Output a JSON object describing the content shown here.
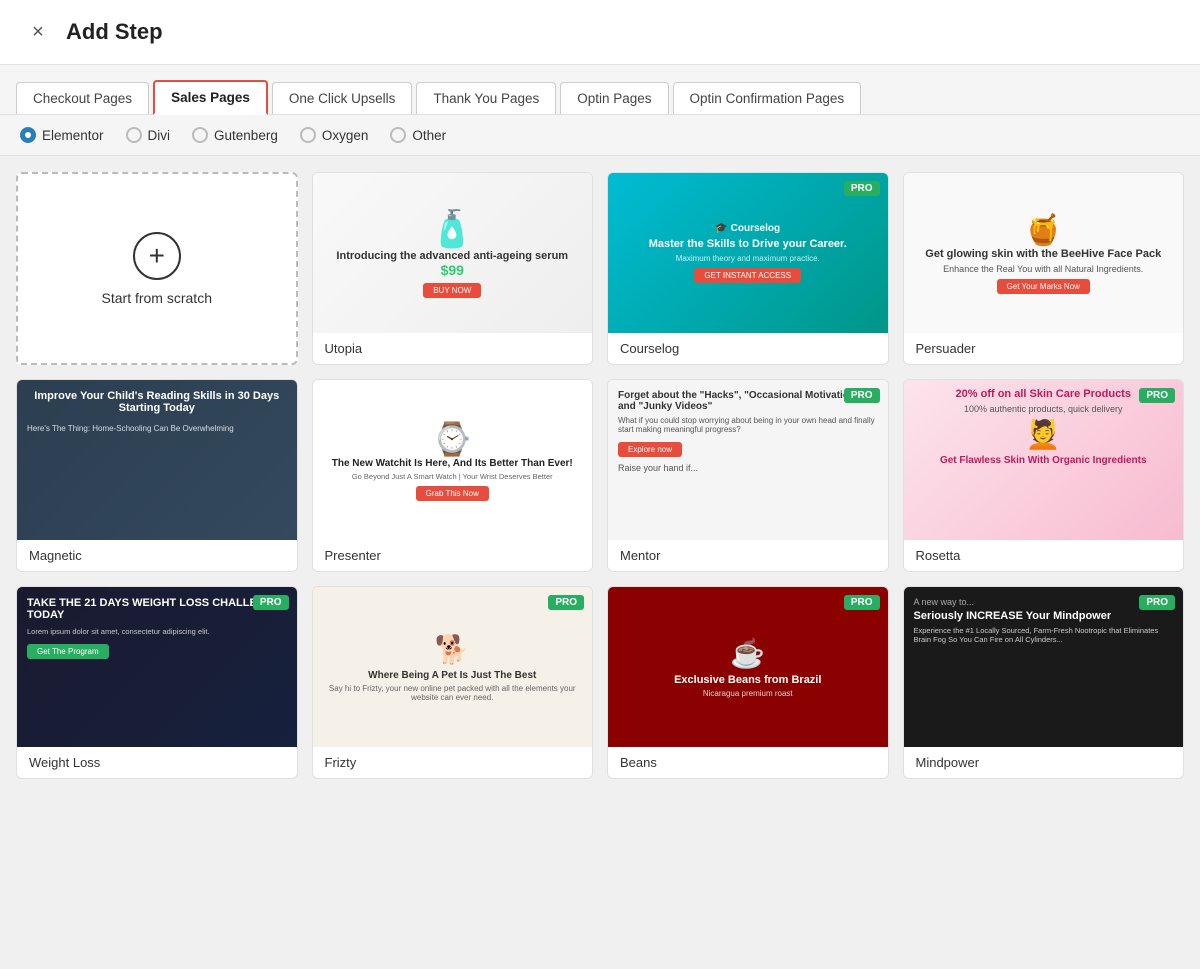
{
  "header": {
    "title": "Add Step",
    "close_label": "×"
  },
  "tabs": [
    {
      "id": "checkout",
      "label": "Checkout Pages",
      "active": false
    },
    {
      "id": "sales",
      "label": "Sales Pages",
      "active": true
    },
    {
      "id": "one-click",
      "label": "One Click Upsells",
      "active": false
    },
    {
      "id": "thankyou",
      "label": "Thank You Pages",
      "active": false
    },
    {
      "id": "optin",
      "label": "Optin Pages",
      "active": false
    },
    {
      "id": "optin-confirm",
      "label": "Optin Confirmation Pages",
      "active": false
    }
  ],
  "builders": [
    {
      "id": "elementor",
      "label": "Elementor",
      "selected": true
    },
    {
      "id": "divi",
      "label": "Divi",
      "selected": false
    },
    {
      "id": "gutenberg",
      "label": "Gutenberg",
      "selected": false
    },
    {
      "id": "oxygen",
      "label": "Oxygen",
      "selected": false
    },
    {
      "id": "other",
      "label": "Other",
      "selected": false
    }
  ],
  "scratch": {
    "label": "Start from scratch"
  },
  "templates": [
    {
      "id": "utopia",
      "name": "Utopia",
      "pro": false,
      "thumb_type": "utopia",
      "description": "Introducing the advanced anti-ageing serum"
    },
    {
      "id": "courselog",
      "name": "Courselog",
      "pro": true,
      "thumb_type": "courselog",
      "description": "Master the Skills to Drive your Career."
    },
    {
      "id": "persuader",
      "name": "Persuader",
      "pro": false,
      "thumb_type": "persuader",
      "description": "Get glowing skin with the BeeHive Face Pack"
    },
    {
      "id": "magnetic",
      "name": "Magnetic",
      "pro": false,
      "thumb_type": "magnetic",
      "description": "Improve Your Child's Reading Skills in 30 Days Starting Today"
    },
    {
      "id": "presenter",
      "name": "Presenter",
      "pro": false,
      "thumb_type": "presenter",
      "description": "Go Beyond Just A Smart Watch | Your Wrist Deserves Better"
    },
    {
      "id": "mentor",
      "name": "Mentor",
      "pro": true,
      "thumb_type": "mentor",
      "description": "Raise your hand if..."
    },
    {
      "id": "rosetta",
      "name": "Rosetta",
      "pro": true,
      "thumb_type": "rosetta",
      "description": "20% off on all Skin Care Products"
    },
    {
      "id": "weightloss",
      "name": "Weight Loss",
      "pro": true,
      "thumb_type": "weightloss",
      "description": "TAKE THE 21 DAYS WEIGHT LOSS CHALLENGE TODAY"
    },
    {
      "id": "frizty",
      "name": "Frizty",
      "pro": true,
      "thumb_type": "frizty",
      "description": "Where Being A Pet Is Just The Best"
    },
    {
      "id": "beans",
      "name": "Beans",
      "pro": true,
      "thumb_type": "beans",
      "description": "Exclusive Beans from Brazil"
    },
    {
      "id": "mindpower",
      "name": "Mindpower",
      "pro": true,
      "thumb_type": "mindpower",
      "description": "Seriously INCREASE Your Mindpower"
    }
  ],
  "pro_badge_label": "PRO",
  "colors": {
    "accent": "#e74c3c",
    "pro_green": "#27ae60",
    "active_tab_border": "#e74c3c"
  }
}
